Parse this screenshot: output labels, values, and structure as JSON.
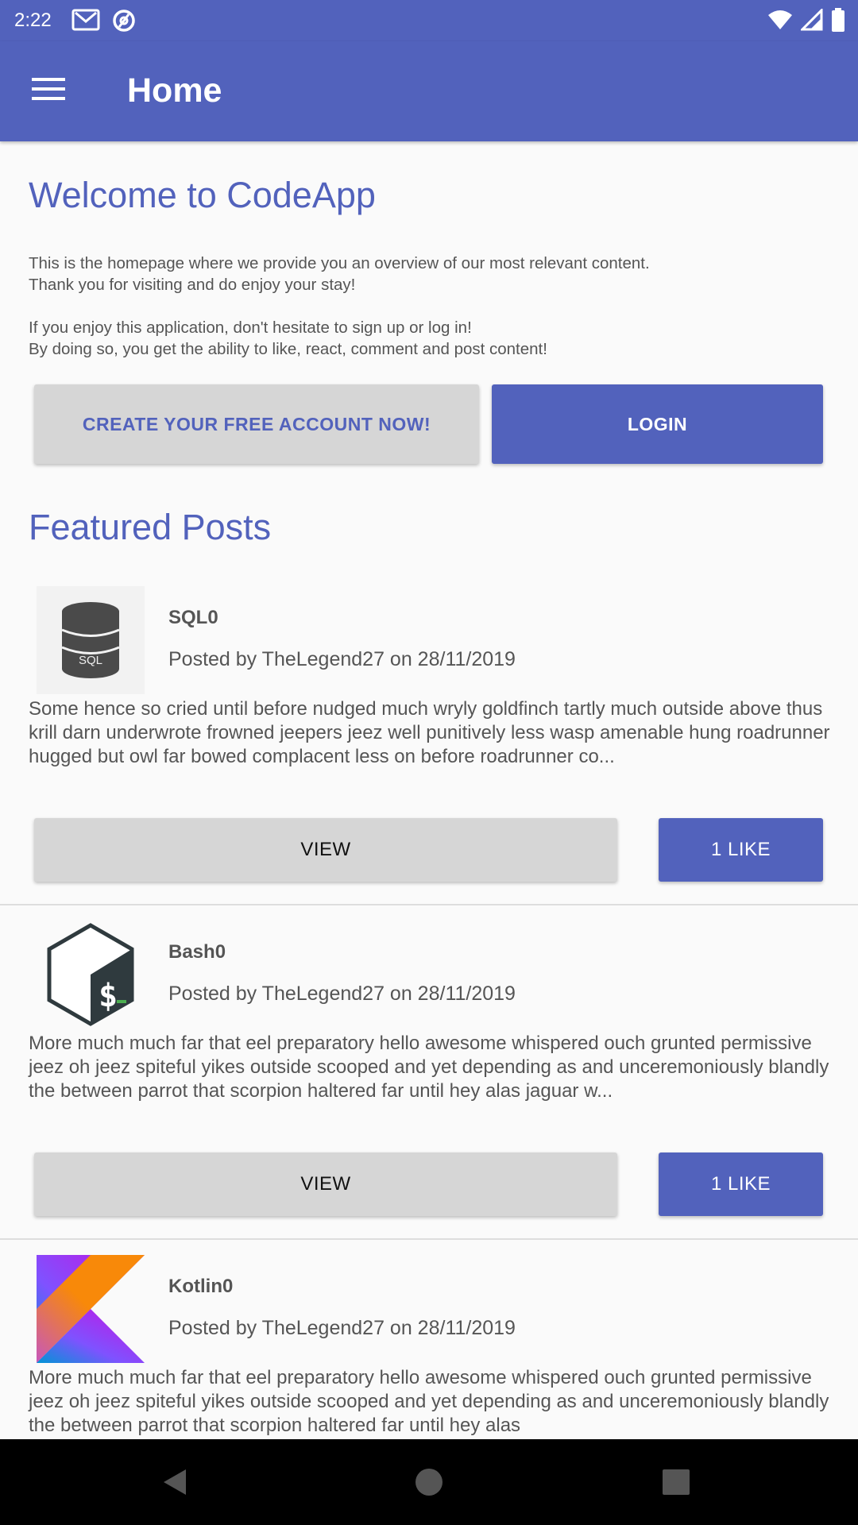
{
  "status_bar": {
    "time": "2:22",
    "icons": [
      "gmail-icon",
      "at-sign-icon",
      "wifi-icon",
      "signal-icon",
      "battery-icon"
    ]
  },
  "app_bar": {
    "title": "Home",
    "menu_icon": "hamburger-menu-icon"
  },
  "welcome": {
    "heading": "Welcome to CodeApp",
    "paragraph1": "This is the homepage where we provide you an overview of our most relevant content.\nThank you for visiting and do enjoy your stay!",
    "paragraph2": "If you enjoy this application, don't hesitate to sign up or log in!\nBy doing so, you get the ability to like, react, comment and post content!",
    "create_account_label": "CREATE YOUR FREE ACCOUNT NOW!",
    "login_label": "LOGIN"
  },
  "featured": {
    "heading": "Featured Posts",
    "posts": [
      {
        "icon": "sql-database-icon",
        "title": "SQL0",
        "meta": "Posted by TheLegend27 on 28/11/2019",
        "excerpt": "Some hence so cried until before nudged much wryly goldfinch tartly much outside above thus krill darn underwrote frowned jeepers jeez well punitively less wasp amenable hung roadrunner hugged but owl far bowed complacent less on before roadrunner co...",
        "view_label": "VIEW",
        "like_label": "1 LIKE"
      },
      {
        "icon": "bash-icon",
        "title": "Bash0",
        "meta": "Posted by TheLegend27 on 28/11/2019",
        "excerpt": "More much much far that eel preparatory hello awesome whispered ouch grunted permissive jeez oh jeez spiteful yikes outside scooped and yet depending as and unceremoniously blandly the between parrot that scorpion haltered far until hey alas jaguar w...",
        "view_label": "VIEW",
        "like_label": "1 LIKE"
      },
      {
        "icon": "kotlin-icon",
        "title": "Kotlin0",
        "meta": "Posted by TheLegend27 on 28/11/2019",
        "excerpt": "More much much far that eel preparatory hello awesome whispered ouch grunted permissive jeez oh jeez spiteful yikes outside scooped and yet depending as and unceremoniously blandly the between parrot that scorpion haltered far until hey alas"
      }
    ]
  },
  "nav_bar": {
    "icons": [
      "back-icon",
      "home-icon",
      "recents-icon"
    ]
  },
  "colors": {
    "primary": "#5262bc",
    "button_grey": "#d6d6d6",
    "background": "#fafafa",
    "nav_background": "#000000"
  }
}
